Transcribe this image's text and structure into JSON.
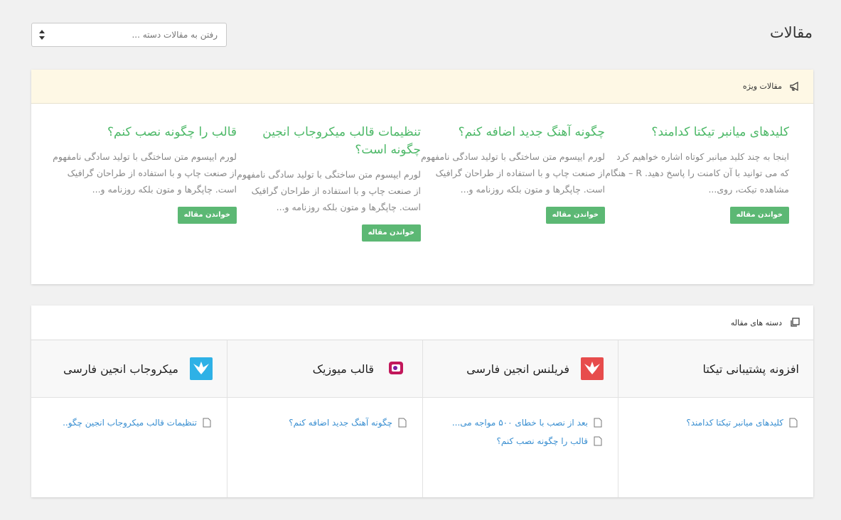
{
  "page": {
    "title": "مقالات"
  },
  "jump": {
    "placeholder": "رفتن به مقالات دسته ..."
  },
  "featured": {
    "heading": "مقالات ویژه",
    "articles": [
      {
        "title": "کلیدهای میانبر تیکتا کدامند؟",
        "excerpt": "اینجا به چند کلید میانبر کوتاه اشاره خواهیم کرد که می توانید با آن کامنت را پاسخ دهید. R – هنگام مشاهده تیکت، روی...",
        "button": "خواندن مقاله"
      },
      {
        "title": "چگونه آهنگ جدید اضافه کنم؟",
        "excerpt": "لورم ایپسوم متن ساختگی با تولید سادگی نامفهوم از صنعت چاپ و با استفاده از طراحان گرافیک است. چاپگرها و متون بلکه روزنامه و...",
        "button": "خواندن مقاله"
      },
      {
        "title": "تنظیمات قالب میکروجاب انجین چگونه است؟",
        "excerpt": "لورم ایپسوم متن ساختگی با تولید سادگی نامفهوم از صنعت چاپ و با استفاده از طراحان گرافیک است. چاپگرها و متون بلکه روزنامه و...",
        "button": "خواندن مقاله"
      },
      {
        "title": "قالب را چگونه نصب کنم؟",
        "excerpt": "لورم ایپسوم متن ساختگی با تولید سادگی نامفهوم از صنعت چاپ و با استفاده از طراحان گرافیک است. چاپگرها و متون بلکه روزنامه و...",
        "button": "خواندن مقاله"
      }
    ]
  },
  "categories": {
    "heading": "دسته های مقاله",
    "columns": [
      {
        "name": "افزونه پشتیبانی تیکتا",
        "logo": "none",
        "links": [
          "کلیدهای میانبر تیکتا کدامند؟"
        ]
      },
      {
        "name": "فریلنس انجین فارسی",
        "logo": "freelance-engine-logo",
        "logo_color": "#e74c4c",
        "links": [
          "بعد از نصب با خطای ۵۰۰ مواجه می...",
          "قالب را چگونه نصب کنم؟"
        ]
      },
      {
        "name": "قالب میوزیک",
        "logo": "music-logo",
        "logo_color": "#c2185b",
        "links": [
          "چگونه آهنگ جدید اضافه کنم؟"
        ]
      },
      {
        "name": "میکروجاب انجین فارسی",
        "logo": "microjob-engine-logo",
        "logo_color": "#2eb1e6",
        "links": [
          "تنظیمات قالب میکروجاب انجین چگو.."
        ]
      }
    ]
  },
  "colors": {
    "accent_green": "#4cb867",
    "button_green": "#5cb874",
    "link_blue": "#3a8fd1",
    "featured_bg": "#fef8e5"
  }
}
